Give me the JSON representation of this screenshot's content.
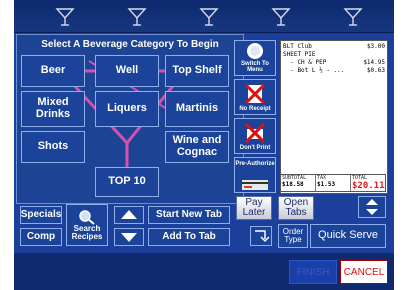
{
  "header": {
    "icons": [
      "martini-glass-icon",
      "martini-glass-icon",
      "martini-glass-icon",
      "martini-glass-icon",
      "martini-glass-icon"
    ]
  },
  "category_panel": {
    "title": "Select A Beverage Category To Begin",
    "buttons": {
      "beer": "Beer",
      "well": "Well",
      "top_shelf": "Top Shelf",
      "mixed_drinks": "Mixed Drinks",
      "liquers": "Liquers",
      "martinis": "Martinis",
      "shots": "Shots",
      "wine_and_cognac": "Wine and Cognac",
      "top10": "TOP 10"
    }
  },
  "bottom_left": {
    "specials": "Specials",
    "comp": "Comp",
    "search_recipes": "Search Recipes",
    "start_new_tab": "Start New Tab",
    "add_to_tab": "Add To Tab"
  },
  "action_buttons": {
    "switch_to_menu": "Switch To Menu",
    "no_receipt": "No Receipt",
    "dont_print": "Don't Print",
    "pre_authorize": "Pre-Authorize"
  },
  "receipt": {
    "lines": [
      {
        "item": "BLT Club",
        "price": "$3.00"
      },
      {
        "item": "SHEET PIE",
        "price": ""
      },
      {
        "item": "  - CH & PEP",
        "price": "$14.95"
      },
      {
        "item": "  - Bot L ½ - ...",
        "price": "$0.63"
      }
    ],
    "totals": {
      "subtotal_label": "SUBTOTAL",
      "subtotal": "$18.58",
      "tax_label": "TAX",
      "tax": "$1.53",
      "total_label": "TOTAL",
      "total": "$20.11"
    }
  },
  "right_bottom": {
    "pay_later": "Pay Later",
    "open_tabs": "Open Tabs",
    "order_type": "Order Type",
    "quick_serve": "Quick Serve"
  },
  "footer": {
    "finish": "FINISH",
    "cancel": "CANCEL"
  },
  "colors": {
    "background": "#1b3f9a",
    "martini_outline": "#d84fb0",
    "total_red": "#e21b1b"
  }
}
